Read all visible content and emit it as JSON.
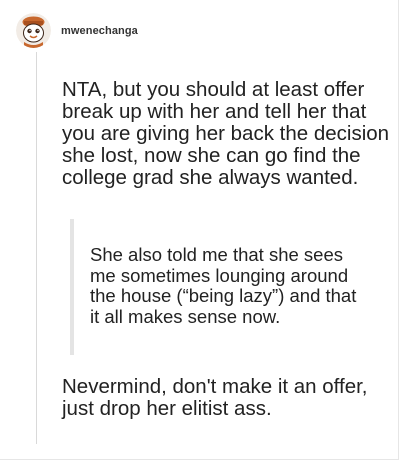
{
  "post": {
    "username": "mwenechanga",
    "avatar_icon": "orange-pumpkin-avatar-icon",
    "paragraph_1": "NTA, but you should at least offer break up with her and tell her that you are giving her back the decision she lost, now she can go find the college grad she always wanted.",
    "quote": "She also told me that she sees me sometimes lounging around the house (“being lazy”) and that it all makes sense now.",
    "paragraph_2": "Nevermind, don't make it an offer, just drop her elitist ass."
  },
  "colors": {
    "avatar_orange": "#c8682e",
    "avatar_dark": "#3b2418",
    "quote_border": "#e4e4e4",
    "thread_line": "#d9d9d9"
  }
}
